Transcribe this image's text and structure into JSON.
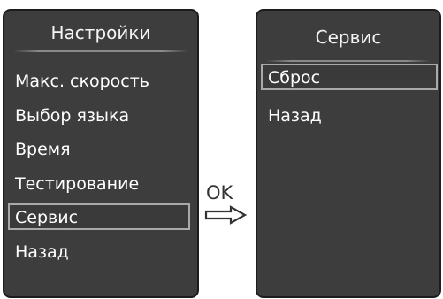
{
  "left_panel": {
    "title": "Настройки",
    "items": [
      {
        "label": "Макс. скорость"
      },
      {
        "label": "Выбор языка"
      },
      {
        "label": "Время"
      },
      {
        "label": "Тестирование"
      },
      {
        "label": "Сервис",
        "selected": true
      },
      {
        "label": "Назад"
      }
    ]
  },
  "transition": {
    "key_label": "OK",
    "icon": "right-outline-arrow-icon"
  },
  "right_panel": {
    "title": "Сервис",
    "items": [
      {
        "label": "Сброс",
        "selected": true
      },
      {
        "label": "Назад"
      }
    ]
  },
  "colors": {
    "panel_background": "#3d3d3d",
    "panel_border": "#1c1c1c",
    "selection_border": "#a9a9a9",
    "text": "#ffffff",
    "arrow": "#333333"
  }
}
